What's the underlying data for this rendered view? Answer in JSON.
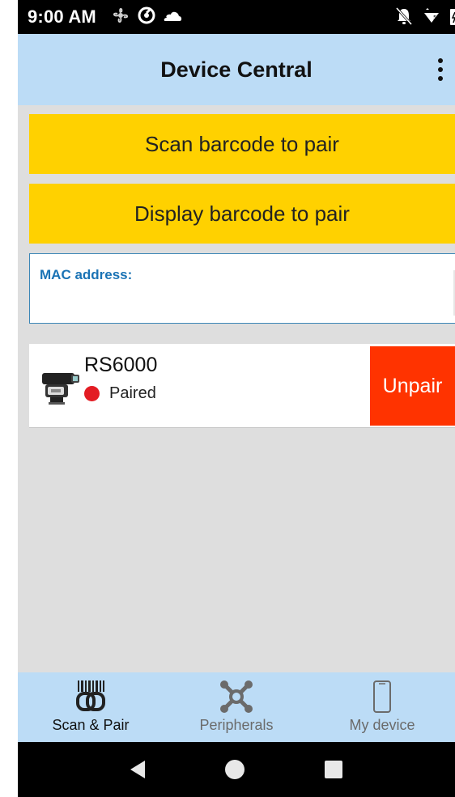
{
  "status_bar": {
    "time": "9:00 AM",
    "left_icons": [
      "fan-icon",
      "sync-icon",
      "cloud-icon"
    ],
    "right_icons": [
      "notifications-off-icon",
      "wifi-icon",
      "battery-icon"
    ]
  },
  "app_bar": {
    "title": "Device Central",
    "menu_icon": "more-vert-icon"
  },
  "actions": {
    "scan_label": "Scan barcode to pair",
    "display_label": "Display barcode to pair"
  },
  "mac": {
    "label": "MAC address:",
    "value": "",
    "placeholder": ""
  },
  "devices": [
    {
      "name": "RS6000",
      "status": "Paired",
      "status_color": "#e31c23",
      "icon": "ring-scanner-icon",
      "action_label": "Unpair",
      "action_color": "#ff3300"
    }
  ],
  "bottom_nav": {
    "items": [
      {
        "label": "Scan & Pair",
        "icon": "barcode-link-icon",
        "active": true
      },
      {
        "label": "Peripherals",
        "icon": "peripherals-icon",
        "active": false
      },
      {
        "label": "My device",
        "icon": "phone-icon",
        "active": false
      }
    ]
  },
  "colors": {
    "accent_blue": "#bcdcf6",
    "button_yellow": "#ffd100",
    "label_blue": "#1a73b5"
  }
}
